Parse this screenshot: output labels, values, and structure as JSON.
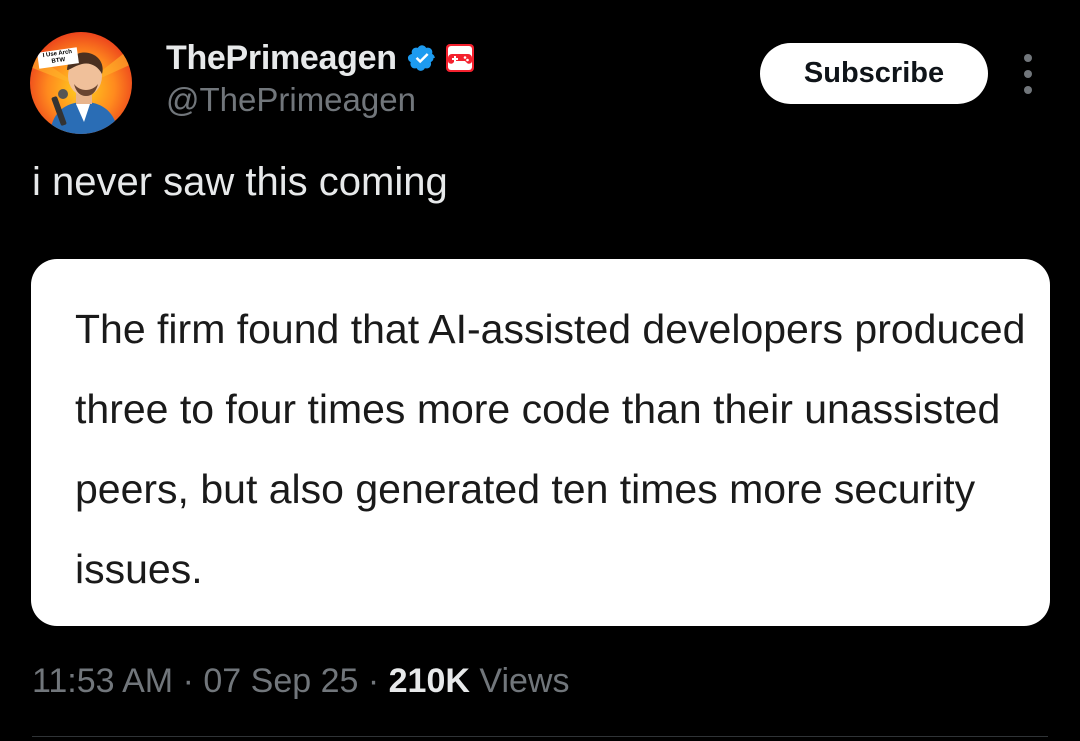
{
  "author": {
    "display_name": "ThePrimeagen",
    "handle": "@ThePrimeagen",
    "avatar_badge_text": "I Use Arch BTW",
    "verified_icon": "verified-badge-icon",
    "affiliate_icon": "gamepad-icon"
  },
  "actions": {
    "subscribe_label": "Subscribe",
    "more_icon": "more-vertical-icon"
  },
  "tweet": {
    "text": "i never saw this coming",
    "media_text": "The firm found that AI-assisted developers produced three to four times more code than their unassisted peers, but also generated ten times more security issues."
  },
  "meta": {
    "time": "11:53 AM",
    "date": "07 Sep 25",
    "views_count": "210K",
    "views_label": "Views"
  },
  "colors": {
    "background": "#000000",
    "primary_text": "#e7e9ea",
    "secondary_text": "#71767b",
    "verified_blue": "#1d9bf0",
    "badge_red": "#f4212e"
  }
}
